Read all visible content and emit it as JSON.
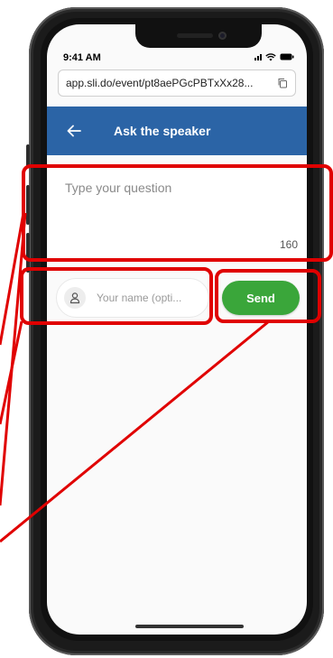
{
  "status_bar": {
    "time": "9:41 AM"
  },
  "browser": {
    "url": "app.sli.do/event/pt8aePGcPBTxXx28..."
  },
  "header": {
    "title": "Ask the speaker"
  },
  "question": {
    "placeholder": "Type your question",
    "char_count": "160"
  },
  "name_input": {
    "placeholder": "Your name (opti..."
  },
  "send_button": {
    "label": "Send"
  },
  "colors": {
    "header_bg": "#2b64a6",
    "send_bg": "#3aa63a",
    "annotation": "#e00000"
  },
  "icons": {
    "back": "arrow-left-icon",
    "copy": "copy-icon",
    "user": "user-icon"
  }
}
